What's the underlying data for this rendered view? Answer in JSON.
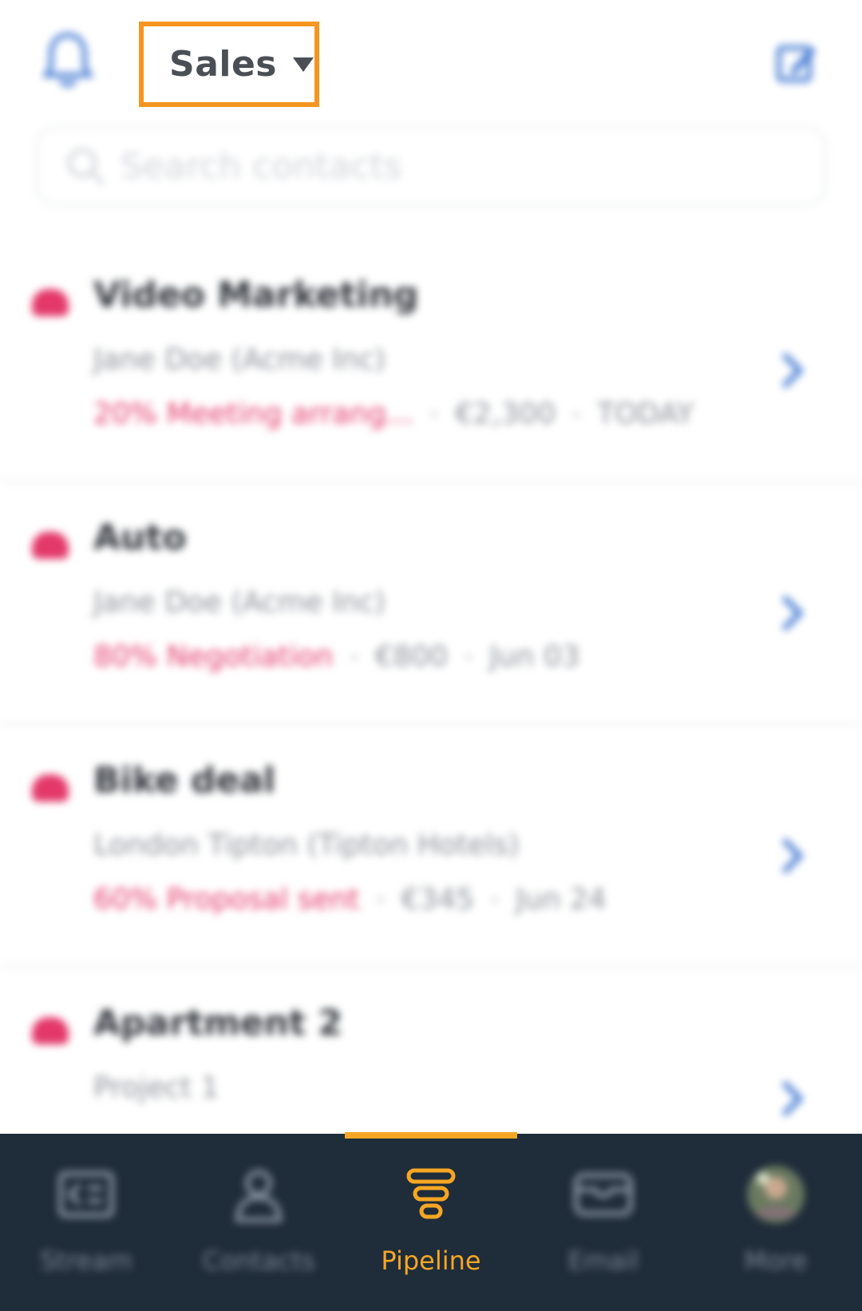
{
  "header": {
    "title": "Sales",
    "notification_icon": "bell-icon",
    "edit_icon": "edit-icon"
  },
  "search": {
    "placeholder": "Search contacts",
    "value": ""
  },
  "deals": [
    {
      "name": "Video Marketing",
      "contact": "Jane Doe (Acme Inc)",
      "stage": "20% Meeting arrang...",
      "amount": "€2,300",
      "date": "TODAY"
    },
    {
      "name": "Auto",
      "contact": "Jane Doe (Acme Inc)",
      "stage": "80% Negotiation",
      "amount": "€800",
      "date": "Jun 03"
    },
    {
      "name": "Bike deal",
      "contact": "London Tipton (Tipton Hotels)",
      "stage": "60% Proposal sent",
      "amount": "€345",
      "date": "Jun 24"
    },
    {
      "name": "Apartment 2",
      "contact": "Project 1",
      "stage": "",
      "amount": "",
      "date": ""
    }
  ],
  "tabbar": {
    "active": "Pipeline",
    "tabs": [
      {
        "label": "Stream",
        "icon": "stream-icon"
      },
      {
        "label": "Contacts",
        "icon": "contacts-icon"
      },
      {
        "label": "Pipeline",
        "icon": "pipeline-icon"
      },
      {
        "label": "Email",
        "icon": "email-icon"
      },
      {
        "label": "More",
        "icon": "avatar-icon"
      }
    ]
  },
  "colors": {
    "accent": "#f5a623",
    "highlight_border": "#f5951f",
    "stage_red": "#e3386a",
    "tabbar_bg": "#1f2c3a",
    "icon_blue": "#4a7fd4"
  }
}
